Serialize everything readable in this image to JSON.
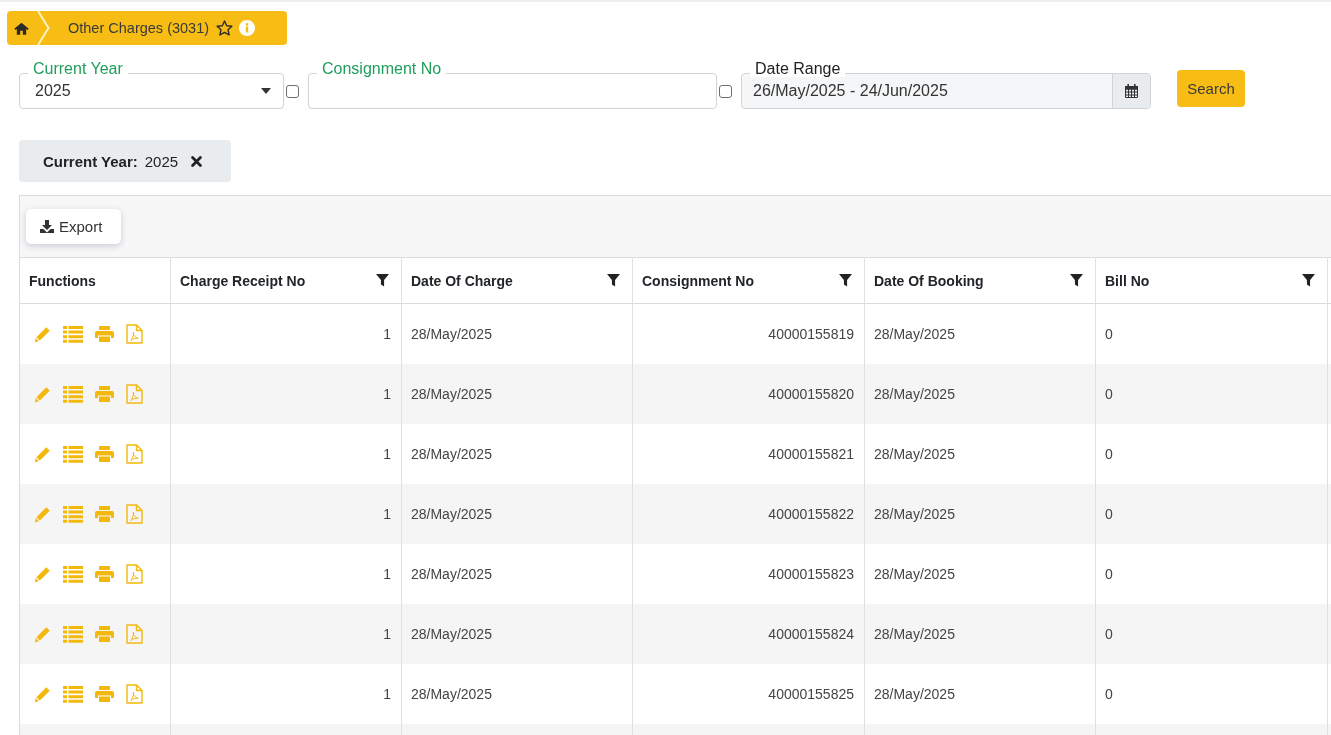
{
  "breadcrumb": {
    "title": "Other Charges (3031)",
    "starred": false
  },
  "filters": [
    {
      "kind": "select",
      "label": "Current Year",
      "value": "2025",
      "checked": false
    },
    {
      "kind": "text",
      "label": "Consignment No",
      "checked": false
    },
    {
      "kind": "daterange",
      "label": "Date Range",
      "value": "26/May/2025 - 24/Jun/2025"
    }
  ],
  "search_button": "Search",
  "active_filters": [
    {
      "label": "Current Year:",
      "value": "2025"
    }
  ],
  "toolbar": {
    "export_button": "Export"
  },
  "table": {
    "columns": [
      {
        "kind": "actions",
        "label": "Functions",
        "filterable": false
      },
      {
        "kind": "number",
        "label": "Charge Receipt No",
        "filterable": true
      },
      {
        "kind": "date",
        "label": "Date Of Charge",
        "filterable": true
      },
      {
        "kind": "number",
        "label": "Consignment No",
        "filterable": true
      },
      {
        "kind": "date",
        "label": "Date Of Booking",
        "filterable": true
      },
      {
        "kind": "text",
        "label": "Bill No",
        "filterable": true
      }
    ],
    "rows": [
      {
        "cells": [
          "",
          "1",
          "28/May/2025",
          "40000155819",
          "28/May/2025",
          "0"
        ]
      },
      {
        "cells": [
          "",
          "1",
          "28/May/2025",
          "40000155820",
          "28/May/2025",
          "0"
        ]
      },
      {
        "cells": [
          "",
          "1",
          "28/May/2025",
          "40000155821",
          "28/May/2025",
          "0"
        ]
      },
      {
        "cells": [
          "",
          "1",
          "28/May/2025",
          "40000155822",
          "28/May/2025",
          "0"
        ]
      },
      {
        "cells": [
          "",
          "1",
          "28/May/2025",
          "40000155823",
          "28/May/2025",
          "0"
        ]
      },
      {
        "cells": [
          "",
          "1",
          "28/May/2025",
          "40000155824",
          "28/May/2025",
          "0"
        ]
      },
      {
        "cells": [
          "",
          "1",
          "28/May/2025",
          "40000155825",
          "28/May/2025",
          "0"
        ]
      }
    ]
  }
}
